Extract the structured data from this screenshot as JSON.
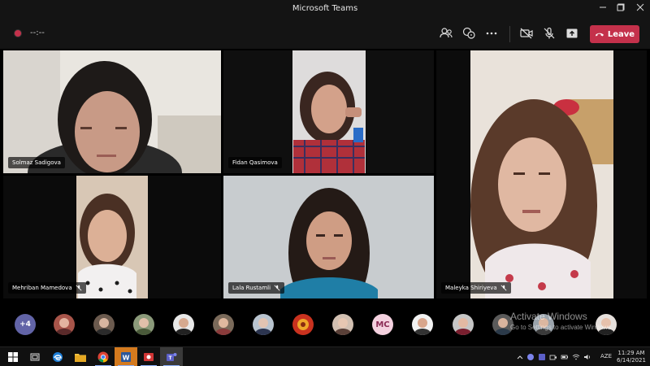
{
  "window": {
    "title": "Microsoft Teams",
    "controls": [
      "minimize-icon",
      "maximize-icon",
      "close-icon"
    ]
  },
  "toolbar": {
    "timer": "--:--",
    "leave_label": "Leave",
    "buttons": [
      "participants-icon",
      "chat-icon",
      "more-options-icon",
      "camera-off-icon",
      "mic-off-icon",
      "share-screen-icon"
    ],
    "accent": "#c4314b"
  },
  "participants": {
    "tiles": [
      {
        "name": "Solmaz Sadigova",
        "muted": false
      },
      {
        "name": "Fidan Qasimova",
        "muted": false
      },
      {
        "name": "Maleyka Shiriyeva",
        "muted": true
      },
      {
        "name": "Mehriban Mamedova",
        "muted": true
      },
      {
        "name": "Lala Rustamli",
        "muted": true
      }
    ],
    "more_count": "+4",
    "strip_initials": "MC"
  },
  "watermark": {
    "line1": "Activate Windows",
    "line2": "Go to Settings to activate Windows."
  },
  "taskbar": {
    "apps": [
      "windows-start-icon",
      "task-view-icon",
      "edge-icon",
      "file-explorer-icon",
      "chrome-icon",
      "word-icon",
      "screen-recorder-icon",
      "teams-icon"
    ],
    "language": "AZE",
    "time": "11:29 AM",
    "date": "6/14/2021"
  }
}
